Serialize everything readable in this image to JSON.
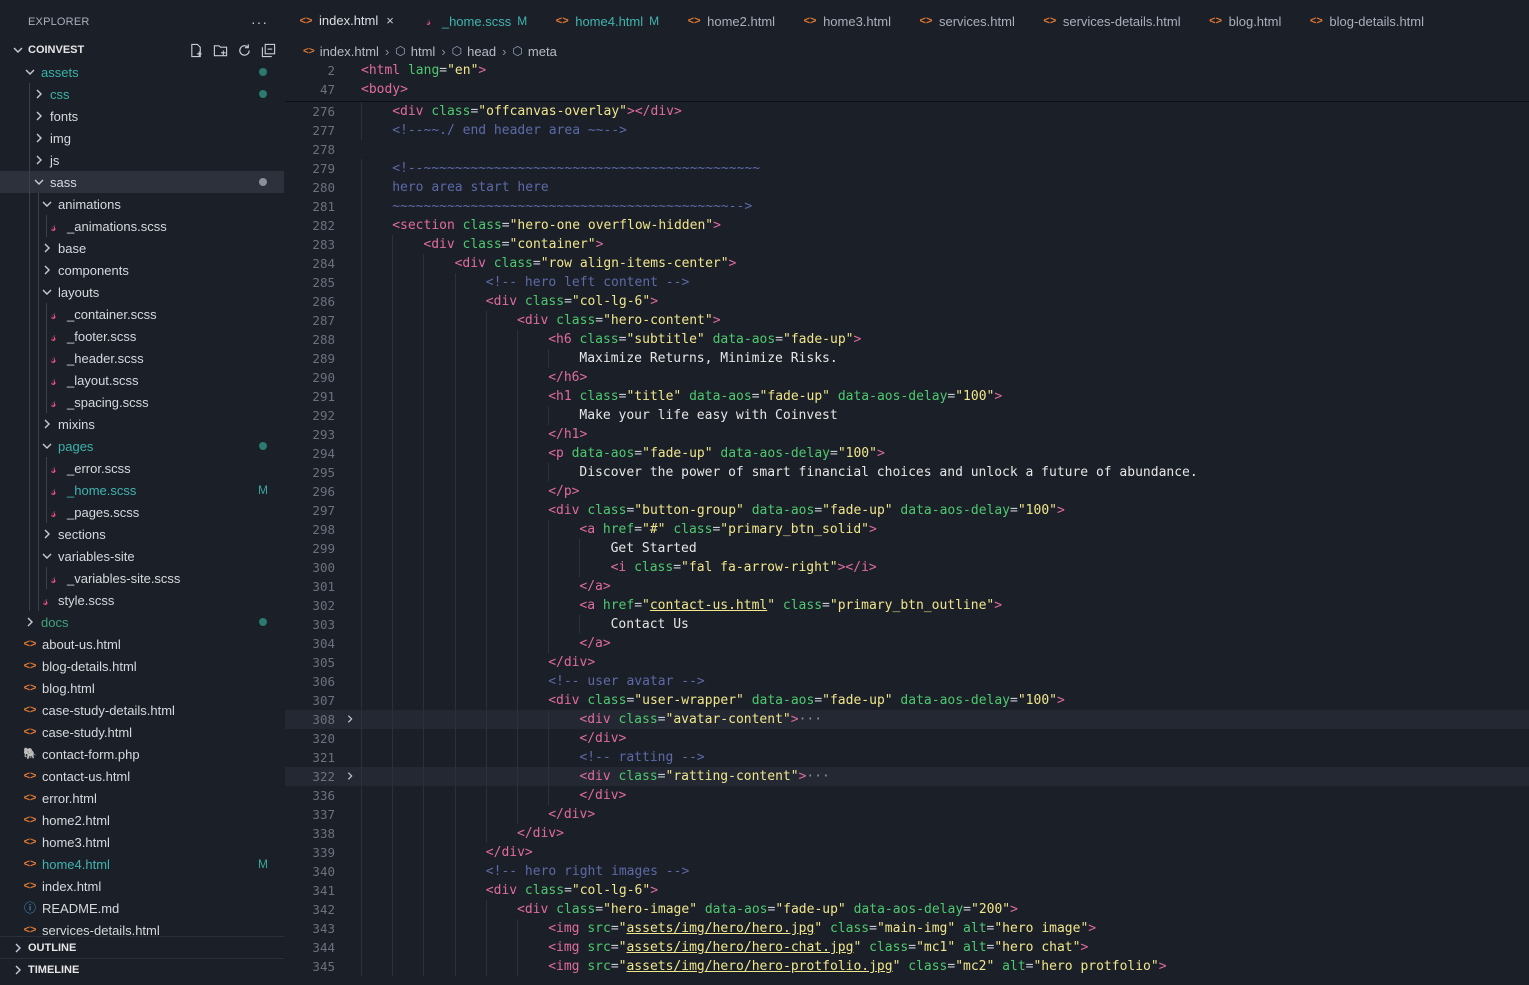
{
  "explorer": {
    "title": "EXPLORER",
    "more": "···",
    "workspace": "COINVEST",
    "outline_label": "OUTLINE",
    "timeline_label": "TIMELINE"
  },
  "tree": [
    {
      "label": "assets",
      "depth": 1,
      "kind": "folder-open",
      "style": "teal",
      "dot": true
    },
    {
      "label": "css",
      "depth": 2,
      "kind": "folder",
      "style": "teal",
      "dot": true
    },
    {
      "label": "fonts",
      "depth": 2,
      "kind": "folder"
    },
    {
      "label": "img",
      "depth": 2,
      "kind": "folder"
    },
    {
      "label": "js",
      "depth": 2,
      "kind": "folder"
    },
    {
      "label": "sass",
      "depth": 2,
      "kind": "folder-open",
      "selected": true,
      "dot": "grey"
    },
    {
      "label": "animations",
      "depth": 3,
      "kind": "folder-open"
    },
    {
      "label": "_animations.scss",
      "depth": 4,
      "kind": "scss"
    },
    {
      "label": "base",
      "depth": 3,
      "kind": "folder"
    },
    {
      "label": "components",
      "depth": 3,
      "kind": "folder"
    },
    {
      "label": "layouts",
      "depth": 3,
      "kind": "folder-open"
    },
    {
      "label": "_container.scss",
      "depth": 4,
      "kind": "scss"
    },
    {
      "label": "_footer.scss",
      "depth": 4,
      "kind": "scss"
    },
    {
      "label": "_header.scss",
      "depth": 4,
      "kind": "scss"
    },
    {
      "label": "_layout.scss",
      "depth": 4,
      "kind": "scss"
    },
    {
      "label": "_spacing.scss",
      "depth": 4,
      "kind": "scss"
    },
    {
      "label": "mixins",
      "depth": 3,
      "kind": "folder"
    },
    {
      "label": "pages",
      "depth": 3,
      "kind": "folder-open",
      "style": "teal",
      "dot": true
    },
    {
      "label": "_error.scss",
      "depth": 4,
      "kind": "scss"
    },
    {
      "label": "_home.scss",
      "depth": 4,
      "kind": "scss",
      "style": "mod",
      "badge": "M"
    },
    {
      "label": "_pages.scss",
      "depth": 4,
      "kind": "scss"
    },
    {
      "label": "sections",
      "depth": 3,
      "kind": "folder"
    },
    {
      "label": "variables-site",
      "depth": 3,
      "kind": "folder-open"
    },
    {
      "label": "_variables-site.scss",
      "depth": 4,
      "kind": "scss"
    },
    {
      "label": "style.scss",
      "depth": 3,
      "kind": "scss-root"
    },
    {
      "label": "docs",
      "depth": 1,
      "kind": "folder",
      "style": "green",
      "dot": true
    },
    {
      "label": "about-us.html",
      "depth": 1,
      "kind": "html"
    },
    {
      "label": "blog-details.html",
      "depth": 1,
      "kind": "html"
    },
    {
      "label": "blog.html",
      "depth": 1,
      "kind": "html"
    },
    {
      "label": "case-study-details.html",
      "depth": 1,
      "kind": "html"
    },
    {
      "label": "case-study.html",
      "depth": 1,
      "kind": "html"
    },
    {
      "label": "contact-form.php",
      "depth": 1,
      "kind": "php"
    },
    {
      "label": "contact-us.html",
      "depth": 1,
      "kind": "html"
    },
    {
      "label": "error.html",
      "depth": 1,
      "kind": "html"
    },
    {
      "label": "home2.html",
      "depth": 1,
      "kind": "html"
    },
    {
      "label": "home3.html",
      "depth": 1,
      "kind": "html"
    },
    {
      "label": "home4.html",
      "depth": 1,
      "kind": "html",
      "style": "mod",
      "badge": "M"
    },
    {
      "label": "index.html",
      "depth": 1,
      "kind": "html"
    },
    {
      "label": "README.md",
      "depth": 1,
      "kind": "info"
    },
    {
      "label": "services-details.html",
      "depth": 1,
      "kind": "html"
    }
  ],
  "tabs": [
    {
      "label": "index.html",
      "kind": "html",
      "active": true,
      "close": "×"
    },
    {
      "label": "_home.scss",
      "kind": "scss",
      "mod": "M"
    },
    {
      "label": "home4.html",
      "kind": "html",
      "mod": "M"
    },
    {
      "label": "home2.html",
      "kind": "html"
    },
    {
      "label": "home3.html",
      "kind": "html"
    },
    {
      "label": "services.html",
      "kind": "html"
    },
    {
      "label": "services-details.html",
      "kind": "html"
    },
    {
      "label": "blog.html",
      "kind": "html"
    },
    {
      "label": "blog-details.html",
      "kind": "html"
    }
  ],
  "breadcrumb": [
    "index.html",
    "html",
    "head",
    "meta"
  ],
  "sticky": [
    {
      "n": "2",
      "indent": 0,
      "t": [
        [
          "tag",
          "<html"
        ],
        [
          "attr",
          " lang"
        ],
        [
          "punc",
          "="
        ],
        [
          "str",
          "\"en\""
        ],
        [
          "tag",
          ">"
        ]
      ]
    },
    {
      "n": "47",
      "indent": 0,
      "t": [
        [
          "tag",
          "<body"
        ],
        [
          "tag",
          ">"
        ]
      ]
    }
  ],
  "lines": [
    {
      "n": "276",
      "indent": 1,
      "t": [
        [
          "tag",
          "<div"
        ],
        [
          "attr",
          " class"
        ],
        [
          "punc",
          "="
        ],
        [
          "str",
          "\"offcanvas-overlay\""
        ],
        [
          "tag",
          "></div>"
        ]
      ]
    },
    {
      "n": "277",
      "indent": 1,
      "t": [
        [
          "com",
          "<!--~~./ end header area ~~-->"
        ]
      ]
    },
    {
      "n": "278",
      "indent": 0,
      "t": []
    },
    {
      "n": "279",
      "indent": 1,
      "t": [
        [
          "com",
          "<!--~~~~~~~~~~~~~~~~~~~~~~~~~~~~~~~~~~~~~~~~~~~"
        ]
      ]
    },
    {
      "n": "280",
      "indent": 1,
      "t": [
        [
          "com",
          "hero area start here"
        ]
      ]
    },
    {
      "n": "281",
      "indent": 1,
      "t": [
        [
          "com",
          "~~~~~~~~~~~~~~~~~~~~~~~~~~~~~~~~~~~~~~~~~~~-->"
        ]
      ]
    },
    {
      "n": "282",
      "indent": 1,
      "t": [
        [
          "tag",
          "<section"
        ],
        [
          "attr",
          " class"
        ],
        [
          "punc",
          "="
        ],
        [
          "str",
          "\"hero-one overflow-hidden\""
        ],
        [
          "tag",
          ">"
        ]
      ]
    },
    {
      "n": "283",
      "indent": 2,
      "t": [
        [
          "tag",
          "<div"
        ],
        [
          "attr",
          " class"
        ],
        [
          "punc",
          "="
        ],
        [
          "str",
          "\"container\""
        ],
        [
          "tag",
          ">"
        ]
      ]
    },
    {
      "n": "284",
      "indent": 3,
      "t": [
        [
          "tag",
          "<div"
        ],
        [
          "attr",
          " class"
        ],
        [
          "punc",
          "="
        ],
        [
          "str",
          "\"row align-items-center\""
        ],
        [
          "tag",
          ">"
        ]
      ]
    },
    {
      "n": "285",
      "indent": 4,
      "t": [
        [
          "com",
          "<!-- hero left content -->"
        ]
      ]
    },
    {
      "n": "286",
      "indent": 4,
      "t": [
        [
          "tag",
          "<div"
        ],
        [
          "attr",
          " class"
        ],
        [
          "punc",
          "="
        ],
        [
          "str",
          "\"col-lg-6\""
        ],
        [
          "tag",
          ">"
        ]
      ]
    },
    {
      "n": "287",
      "indent": 5,
      "t": [
        [
          "tag",
          "<div"
        ],
        [
          "attr",
          " class"
        ],
        [
          "punc",
          "="
        ],
        [
          "str",
          "\"hero-content\""
        ],
        [
          "tag",
          ">"
        ]
      ]
    },
    {
      "n": "288",
      "indent": 6,
      "t": [
        [
          "tag",
          "<h6"
        ],
        [
          "attr",
          " class"
        ],
        [
          "punc",
          "="
        ],
        [
          "str",
          "\"subtitle\""
        ],
        [
          "attr",
          " data-aos"
        ],
        [
          "punc",
          "="
        ],
        [
          "str",
          "\"fade-up\""
        ],
        [
          "tag",
          ">"
        ]
      ]
    },
    {
      "n": "289",
      "indent": 7,
      "t": [
        [
          "txt",
          "Maximize Returns, Minimize Risks."
        ]
      ]
    },
    {
      "n": "290",
      "indent": 6,
      "t": [
        [
          "tag",
          "</h6>"
        ]
      ]
    },
    {
      "n": "291",
      "indent": 6,
      "t": [
        [
          "tag",
          "<h1"
        ],
        [
          "attr",
          " class"
        ],
        [
          "punc",
          "="
        ],
        [
          "str",
          "\"title\""
        ],
        [
          "attr",
          " data-aos"
        ],
        [
          "punc",
          "="
        ],
        [
          "str",
          "\"fade-up\""
        ],
        [
          "attr",
          " data-aos-delay"
        ],
        [
          "punc",
          "="
        ],
        [
          "str",
          "\"100\""
        ],
        [
          "tag",
          ">"
        ]
      ]
    },
    {
      "n": "292",
      "indent": 7,
      "t": [
        [
          "txt",
          "Make your life easy with Coinvest"
        ]
      ]
    },
    {
      "n": "293",
      "indent": 6,
      "t": [
        [
          "tag",
          "</h1>"
        ]
      ]
    },
    {
      "n": "294",
      "indent": 6,
      "t": [
        [
          "tag",
          "<p"
        ],
        [
          "attr",
          " data-aos"
        ],
        [
          "punc",
          "="
        ],
        [
          "str",
          "\"fade-up\""
        ],
        [
          "attr",
          " data-aos-delay"
        ],
        [
          "punc",
          "="
        ],
        [
          "str",
          "\"100\""
        ],
        [
          "tag",
          ">"
        ]
      ]
    },
    {
      "n": "295",
      "indent": 7,
      "t": [
        [
          "txt",
          "Discover the power of smart financial choices and unlock a future of abundance."
        ]
      ]
    },
    {
      "n": "296",
      "indent": 6,
      "t": [
        [
          "tag",
          "</p>"
        ]
      ]
    },
    {
      "n": "297",
      "indent": 6,
      "t": [
        [
          "tag",
          "<div"
        ],
        [
          "attr",
          " class"
        ],
        [
          "punc",
          "="
        ],
        [
          "str",
          "\"button-group\""
        ],
        [
          "attr",
          " data-aos"
        ],
        [
          "punc",
          "="
        ],
        [
          "str",
          "\"fade-up\""
        ],
        [
          "attr",
          " data-aos-delay"
        ],
        [
          "punc",
          "="
        ],
        [
          "str",
          "\"100\""
        ],
        [
          "tag",
          ">"
        ]
      ]
    },
    {
      "n": "298",
      "indent": 7,
      "t": [
        [
          "tag",
          "<a"
        ],
        [
          "attr",
          " href"
        ],
        [
          "punc",
          "="
        ],
        [
          "str",
          "\"#\""
        ],
        [
          "attr",
          " class"
        ],
        [
          "punc",
          "="
        ],
        [
          "str",
          "\"primary_btn_solid\""
        ],
        [
          "tag",
          ">"
        ]
      ]
    },
    {
      "n": "299",
      "indent": 8,
      "t": [
        [
          "txt",
          "Get Started"
        ]
      ]
    },
    {
      "n": "300",
      "indent": 8,
      "t": [
        [
          "tag",
          "<i"
        ],
        [
          "attr",
          " class"
        ],
        [
          "punc",
          "="
        ],
        [
          "str",
          "\"fal fa-arrow-right\""
        ],
        [
          "tag",
          "></i>"
        ]
      ]
    },
    {
      "n": "301",
      "indent": 7,
      "t": [
        [
          "tag",
          "</a>"
        ]
      ]
    },
    {
      "n": "302",
      "indent": 7,
      "t": [
        [
          "tag",
          "<a"
        ],
        [
          "attr",
          " href"
        ],
        [
          "punc",
          "="
        ],
        [
          "str",
          "\""
        ],
        [
          "link",
          "contact-us.html"
        ],
        [
          "str",
          "\""
        ],
        [
          "attr",
          " class"
        ],
        [
          "punc",
          "="
        ],
        [
          "str",
          "\"primary_btn_outline\""
        ],
        [
          "tag",
          ">"
        ]
      ]
    },
    {
      "n": "303",
      "indent": 8,
      "t": [
        [
          "txt",
          "Contact Us"
        ]
      ]
    },
    {
      "n": "304",
      "indent": 7,
      "t": [
        [
          "tag",
          "</a>"
        ]
      ]
    },
    {
      "n": "305",
      "indent": 6,
      "t": [
        [
          "tag",
          "</div>"
        ]
      ]
    },
    {
      "n": "306",
      "indent": 6,
      "t": [
        [
          "com",
          "<!-- user avatar -->"
        ]
      ]
    },
    {
      "n": "307",
      "indent": 6,
      "t": [
        [
          "tag",
          "<div"
        ],
        [
          "attr",
          " class"
        ],
        [
          "punc",
          "="
        ],
        [
          "str",
          "\"user-wrapper\""
        ],
        [
          "attr",
          " data-aos"
        ],
        [
          "punc",
          "="
        ],
        [
          "str",
          "\"fade-up\""
        ],
        [
          "attr",
          " data-aos-delay"
        ],
        [
          "punc",
          "="
        ],
        [
          "str",
          "\"100\""
        ],
        [
          "tag",
          ">"
        ]
      ]
    },
    {
      "n": "308",
      "indent": 7,
      "fold": true,
      "hl": true,
      "t": [
        [
          "tag",
          "<div"
        ],
        [
          "attr",
          " class"
        ],
        [
          "punc",
          "="
        ],
        [
          "str",
          "\"avatar-content\""
        ],
        [
          "tag",
          ">"
        ],
        [
          "ell",
          "···"
        ]
      ]
    },
    {
      "n": "320",
      "indent": 7,
      "t": [
        [
          "tag",
          "</div>"
        ]
      ]
    },
    {
      "n": "321",
      "indent": 7,
      "t": [
        [
          "com",
          "<!-- ratting -->"
        ]
      ]
    },
    {
      "n": "322",
      "indent": 7,
      "fold": true,
      "hl": true,
      "t": [
        [
          "tag",
          "<div"
        ],
        [
          "attr",
          " class"
        ],
        [
          "punc",
          "="
        ],
        [
          "str",
          "\"ratting-content\""
        ],
        [
          "tag",
          ">"
        ],
        [
          "ell",
          "···"
        ]
      ]
    },
    {
      "n": "336",
      "indent": 7,
      "t": [
        [
          "tag",
          "</div>"
        ]
      ]
    },
    {
      "n": "337",
      "indent": 6,
      "t": [
        [
          "tag",
          "</div>"
        ]
      ]
    },
    {
      "n": "338",
      "indent": 5,
      "t": [
        [
          "tag",
          "</div>"
        ]
      ]
    },
    {
      "n": "339",
      "indent": 4,
      "t": [
        [
          "tag",
          "</div>"
        ]
      ]
    },
    {
      "n": "340",
      "indent": 4,
      "t": [
        [
          "com",
          "<!-- hero right images -->"
        ]
      ]
    },
    {
      "n": "341",
      "indent": 4,
      "t": [
        [
          "tag",
          "<div"
        ],
        [
          "attr",
          " class"
        ],
        [
          "punc",
          "="
        ],
        [
          "str",
          "\"col-lg-6\""
        ],
        [
          "tag",
          ">"
        ]
      ]
    },
    {
      "n": "342",
      "indent": 5,
      "t": [
        [
          "tag",
          "<div"
        ],
        [
          "attr",
          " class"
        ],
        [
          "punc",
          "="
        ],
        [
          "str",
          "\"hero-image\""
        ],
        [
          "attr",
          " data-aos"
        ],
        [
          "punc",
          "="
        ],
        [
          "str",
          "\"fade-up\""
        ],
        [
          "attr",
          " data-aos-delay"
        ],
        [
          "punc",
          "="
        ],
        [
          "str",
          "\"200\""
        ],
        [
          "tag",
          ">"
        ]
      ]
    },
    {
      "n": "343",
      "indent": 6,
      "t": [
        [
          "tag",
          "<img"
        ],
        [
          "attr",
          " src"
        ],
        [
          "punc",
          "="
        ],
        [
          "str",
          "\""
        ],
        [
          "link",
          "assets/img/hero/hero.jpg"
        ],
        [
          "str",
          "\""
        ],
        [
          "attr",
          " class"
        ],
        [
          "punc",
          "="
        ],
        [
          "str",
          "\"main-img\""
        ],
        [
          "attr",
          " alt"
        ],
        [
          "punc",
          "="
        ],
        [
          "str",
          "\"hero image\""
        ],
        [
          "tag",
          ">"
        ]
      ]
    },
    {
      "n": "344",
      "indent": 6,
      "t": [
        [
          "tag",
          "<img"
        ],
        [
          "attr",
          " src"
        ],
        [
          "punc",
          "="
        ],
        [
          "str",
          "\""
        ],
        [
          "link",
          "assets/img/hero/hero-chat.jpg"
        ],
        [
          "str",
          "\""
        ],
        [
          "attr",
          " class"
        ],
        [
          "punc",
          "="
        ],
        [
          "str",
          "\"mc1\""
        ],
        [
          "attr",
          " alt"
        ],
        [
          "punc",
          "="
        ],
        [
          "str",
          "\"hero chat\""
        ],
        [
          "tag",
          ">"
        ]
      ]
    },
    {
      "n": "345",
      "indent": 6,
      "t": [
        [
          "tag",
          "<img"
        ],
        [
          "attr",
          " src"
        ],
        [
          "punc",
          "="
        ],
        [
          "str",
          "\""
        ],
        [
          "link",
          "assets/img/hero/hero-protfolio.jpg"
        ],
        [
          "str",
          "\""
        ],
        [
          "attr",
          " class"
        ],
        [
          "punc",
          "="
        ],
        [
          "str",
          "\"mc2\""
        ],
        [
          "attr",
          " alt"
        ],
        [
          "punc",
          "="
        ],
        [
          "str",
          "\"hero protfolio\""
        ],
        [
          "tag",
          ">"
        ]
      ]
    }
  ]
}
